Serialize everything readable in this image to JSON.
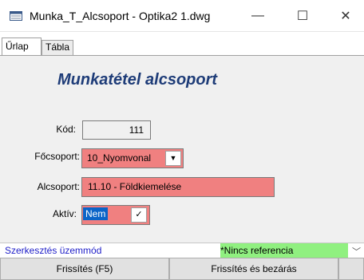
{
  "window": {
    "title": "Munka_T_Alcsoport - Optika2 1.dwg",
    "icon": "form-window-icon",
    "minimize_glyph": "—",
    "maximize_glyph": "☐",
    "close_glyph": "✕"
  },
  "tabs": [
    {
      "label": "Űrlap",
      "active": true
    },
    {
      "label": "Tábla",
      "active": false
    }
  ],
  "form": {
    "title": "Munkatétel alcsoport",
    "fields": {
      "kod": {
        "label": "Kód:",
        "value": "111"
      },
      "focsoport": {
        "label": "Főcsoport:",
        "value": "10_Nyomvonal"
      },
      "alcsoport": {
        "label": "Alcsoport:",
        "value": "11.10 - Földkiemelése"
      },
      "aktiv": {
        "label": "Aktív:",
        "value": "Nem"
      }
    }
  },
  "status": {
    "mode": "Szerkesztés üzemmód",
    "reference": "*Nincs referencia"
  },
  "buttons": {
    "refresh": "Frissítés (F5)",
    "refresh_close": "Frissítés és bezárás"
  },
  "colors": {
    "title_accent": "#1e3c78",
    "field_highlight": "#f08080",
    "status_reference_bg": "#90f080",
    "status_mode_text": "#1e1ec8",
    "selected_text_bg": "#0a64c8"
  }
}
